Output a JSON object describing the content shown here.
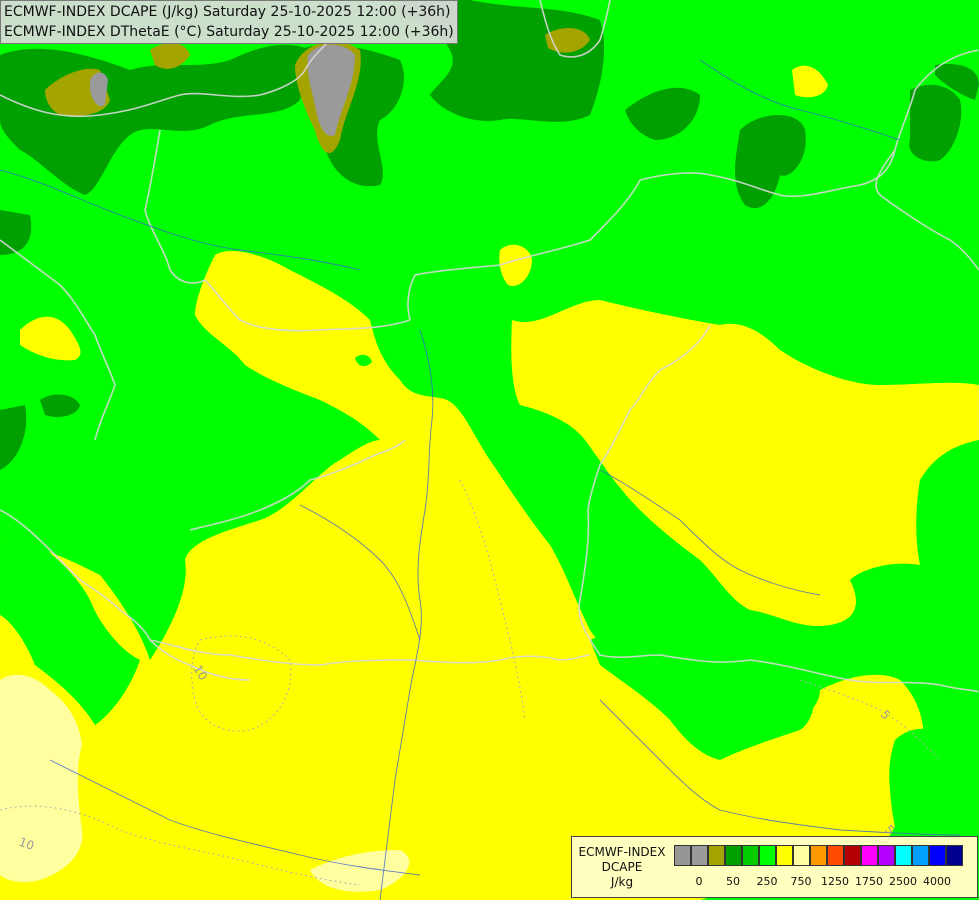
{
  "title": {
    "line1": "ECMWF-INDEX DCAPE (J/kg) Saturday 25-10-2025 12:00 (+36h)",
    "line2": "ECMWF-INDEX DThetaE (°C) Saturday 25-10-2025 12:00 (+36h)"
  },
  "legend": {
    "title_line1": "ECMWF-INDEX",
    "title_line2": "DCAPE",
    "title_line3": "J/kg",
    "colors": [
      "#969696",
      "#9a9a9a",
      "#a4a400",
      "#00a000",
      "#00cc00",
      "#00ff00",
      "#ffff00",
      "#ffffa0",
      "#ff9a00",
      "#ff4a00",
      "#b40000",
      "#ff00ff",
      "#b400ff",
      "#00ffff",
      "#00a0ff",
      "#0000ff",
      "#000090"
    ],
    "ticks": [
      "0",
      "50",
      "250",
      "750",
      "1250",
      "1750",
      "2500",
      "4000"
    ]
  },
  "contour_labels": [
    "10",
    "10",
    "5",
    "5"
  ],
  "colors": {
    "green_bright": "#00ff00",
    "green_dark": "#00a000",
    "olive": "#a4a400",
    "gray": "#9a9a9a",
    "yellow": "#ffff00",
    "pale_yellow": "#ffffa0"
  }
}
